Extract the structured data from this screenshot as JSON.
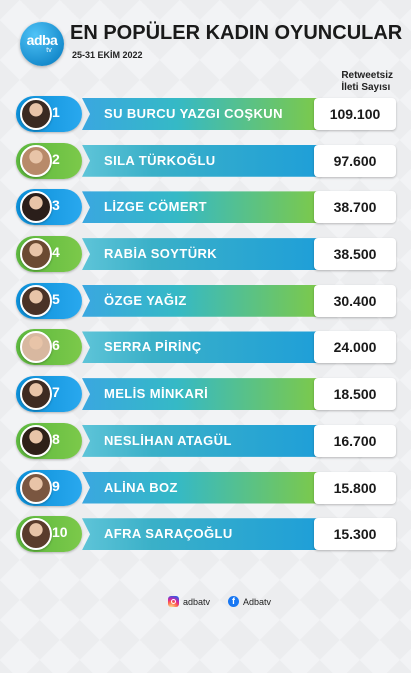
{
  "header": {
    "logo_text": "adba",
    "logo_sub": "tv",
    "title": "EN POPÜLER KADIN OYUNCULAR",
    "date_range": "25-31 EKİM 2022"
  },
  "column_header": {
    "line1": "Retweetsiz",
    "line2": "İleti Sayısı"
  },
  "chart_data": {
    "type": "table",
    "title": "EN POPÜLER KADIN OYUNCULAR",
    "subtitle": "25-31 EKİM 2022",
    "value_label": "Retweetsiz İleti Sayısı",
    "rows": [
      {
        "rank": "1",
        "name": "SU BURCU YAZGI COŞKUN",
        "value": "109.100"
      },
      {
        "rank": "2",
        "name": "SILA TÜRKOĞLU",
        "value": "97.600"
      },
      {
        "rank": "3",
        "name": "LİZGE CÖMERT",
        "value": "38.700"
      },
      {
        "rank": "4",
        "name": "RABİA SOYTÜRK",
        "value": "38.500"
      },
      {
        "rank": "5",
        "name": "ÖZGE YAĞIZ",
        "value": "30.400"
      },
      {
        "rank": "6",
        "name": "SERRA PİRİNÇ",
        "value": "24.000"
      },
      {
        "rank": "7",
        "name": "MELİS MİNKARİ",
        "value": "18.500"
      },
      {
        "rank": "8",
        "name": "NESLİHAN ATAGÜL",
        "value": "16.700"
      },
      {
        "rank": "9",
        "name": "ALİNA BOZ",
        "value": "15.800"
      },
      {
        "rank": "10",
        "name": "AFRA SARAÇOĞLU",
        "value": "15.300"
      }
    ]
  },
  "avatar_colors": [
    "#3a2a22",
    "#b88a6a",
    "#2a1e1a",
    "#6b4a32",
    "#4a3226",
    "#d8b8a0",
    "#3e2b22",
    "#2e2018",
    "#7a5640",
    "#5a3c2c"
  ],
  "footer": {
    "instagram_handle": "adbatv",
    "facebook_handle": "Adbatv",
    "instagram_icon": "instagram-icon",
    "facebook_icon": "facebook-icon"
  }
}
